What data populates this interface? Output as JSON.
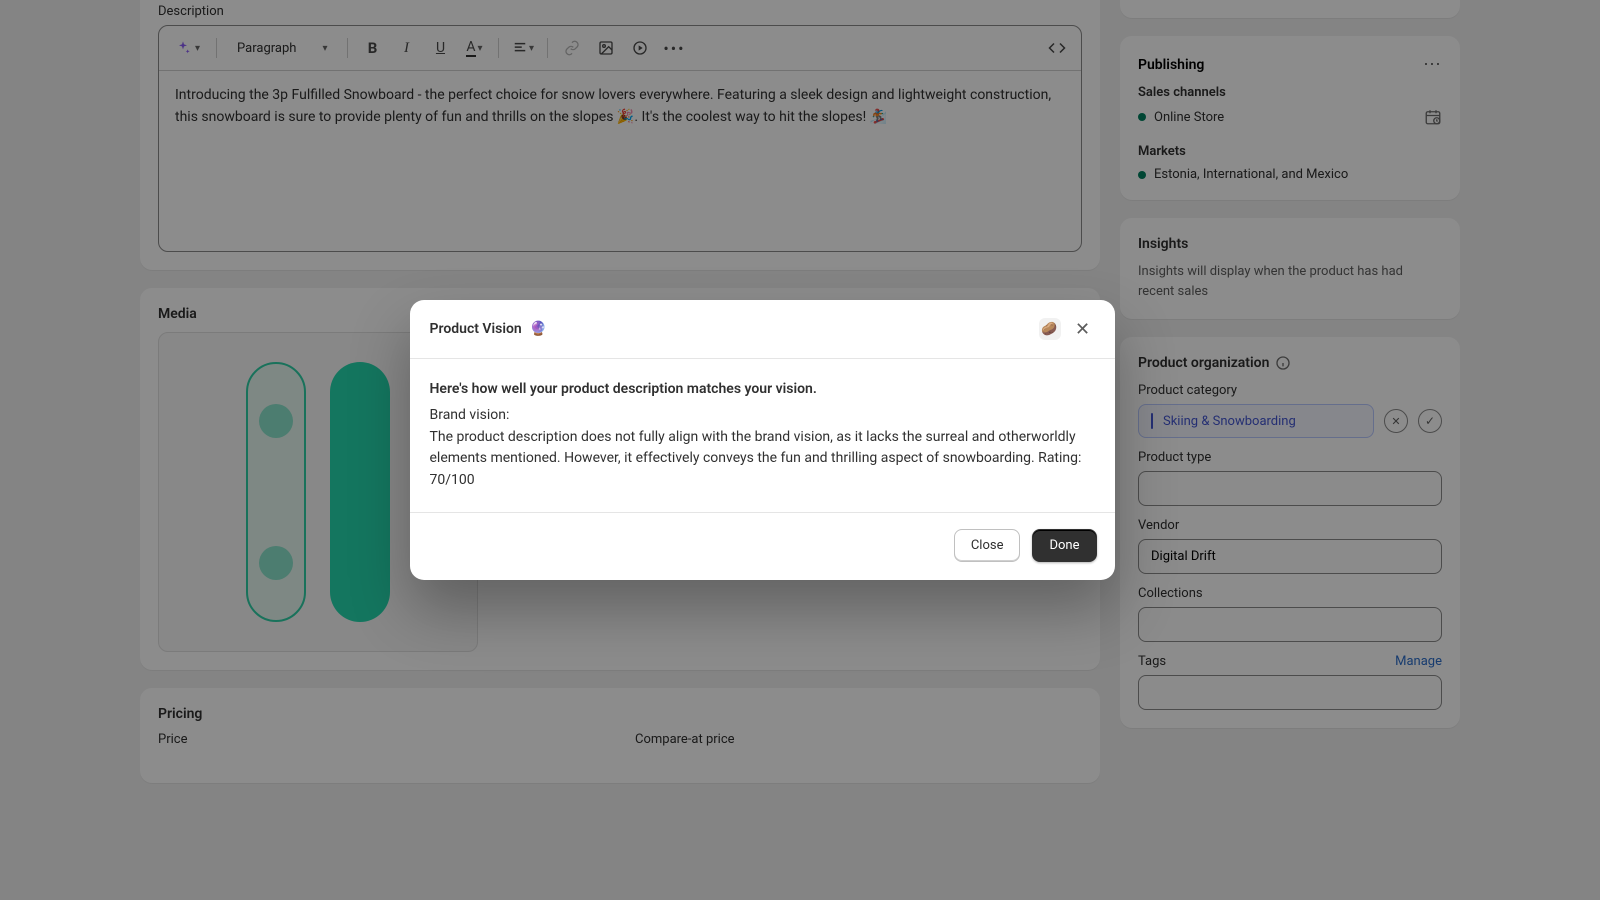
{
  "description": {
    "label": "Description",
    "paragraph_selector": "Paragraph",
    "body": "Introducing the 3p Fulfilled Snowboard - the perfect choice for snow lovers everywhere. Featuring a sleek design and lightweight construction, this snowboard is sure to provide plenty of fun and thrills on the slopes 🎉. It's the coolest way to hit the slopes! 🏂"
  },
  "media": {
    "title": "Media"
  },
  "pricing": {
    "title": "Pricing",
    "price_label": "Price",
    "compare_label": "Compare-at price"
  },
  "publishing": {
    "title": "Publishing",
    "sales_channels_label": "Sales channels",
    "channel1": "Online Store",
    "markets_label": "Markets",
    "markets_value": "Estonia, International, and Mexico"
  },
  "insights": {
    "title": "Insights",
    "text": "Insights will display when the product has had recent sales"
  },
  "organization": {
    "title": "Product organization",
    "category_label": "Product category",
    "category_value": "Skiing & Snowboarding",
    "type_label": "Product type",
    "type_value": "",
    "vendor_label": "Vendor",
    "vendor_value": "Digital Drift",
    "collections_label": "Collections",
    "collections_value": "",
    "tags_label": "Tags",
    "manage_label": "Manage",
    "tags_value": ""
  },
  "modal": {
    "title": "Product Vision",
    "emoji": "🔮",
    "pill_emoji": "🥔",
    "heading": "Here's how well your product description matches your vision.",
    "brand_label": "Brand vision:",
    "body": "The product description does not fully align with the brand vision, as it lacks the surreal and otherworldly elements mentioned. However, it effectively conveys the fun and thrilling aspect of snowboarding. Rating: 70/100",
    "close": "Close",
    "done": "Done"
  }
}
